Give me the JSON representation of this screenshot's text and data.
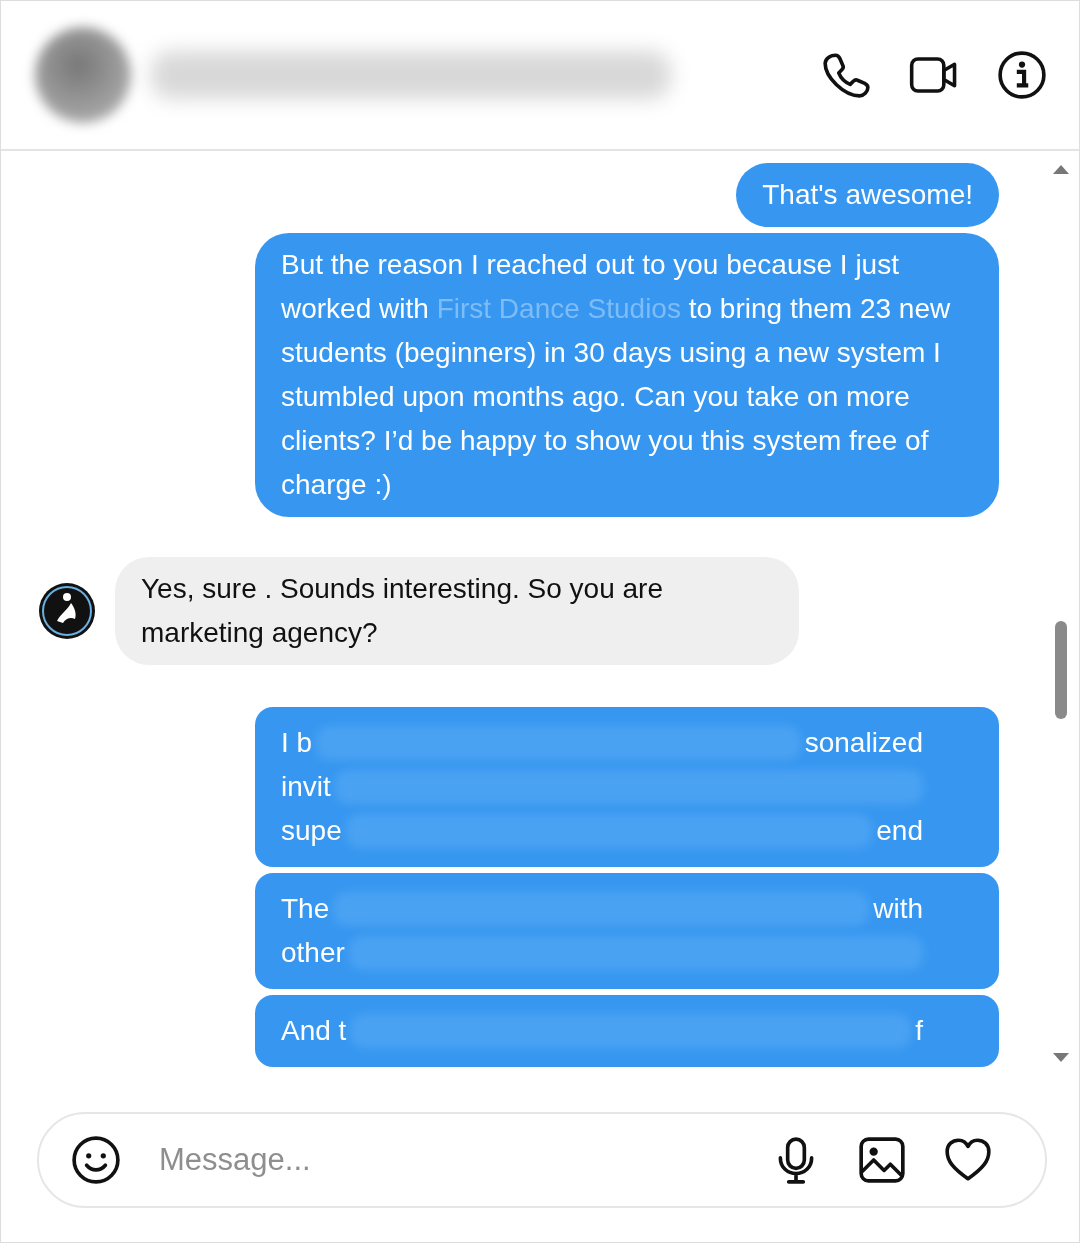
{
  "header": {
    "name_blurred": true
  },
  "messages": [
    {
      "kind": "sent",
      "parts": [
        {
          "text": "That's awesome!",
          "faded": false
        }
      ]
    },
    {
      "kind": "sent",
      "parts": [
        {
          "text": "But the reason I reached out to you because I just worked with ",
          "faded": false
        },
        {
          "text": "First Dance Studios",
          "faded": true
        },
        {
          "text": " to bring them 23 new students (beginners) in 30 days using a new system I stumbled upon months ago. Can you take on more clients? I’d be happy to show you this system free of charge :)",
          "faded": false
        }
      ]
    },
    {
      "kind": "received",
      "parts": [
        {
          "text": "Yes, sure . Sounds interesting. So you are marketing agency?",
          "faded": false
        }
      ]
    },
    {
      "kind": "blurred",
      "lines": [
        {
          "left": "I b",
          "right": "sonalized"
        },
        {
          "left": "invit"
        },
        {
          "left": "supe",
          "right": "end"
        }
      ]
    },
    {
      "kind": "blurred",
      "lines": [
        {
          "left": "The",
          "right": "with"
        },
        {
          "left": "other"
        }
      ]
    },
    {
      "kind": "blurred",
      "lines": [
        {
          "left": "And t",
          "right": "f"
        }
      ]
    }
  ],
  "composer": {
    "placeholder": "Message..."
  }
}
